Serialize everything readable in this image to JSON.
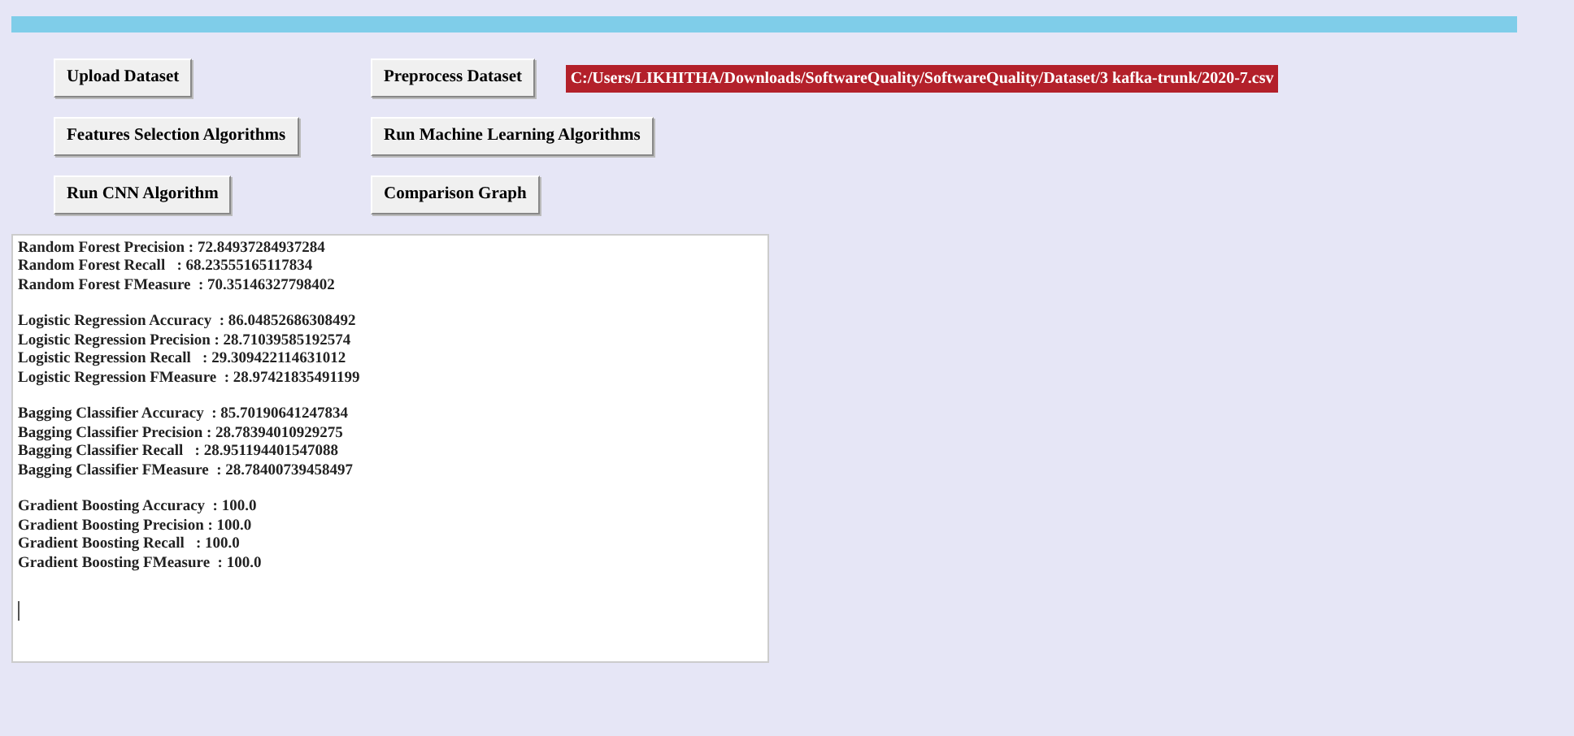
{
  "buttons": [
    [
      "Upload Dataset",
      "Preprocess Dataset"
    ],
    [
      "Features Selection Algorithms",
      "Run Machine Learning Algorithms"
    ],
    [
      "Run CNN Algorithm",
      "Comparison Graph"
    ]
  ],
  "file_path": "C:/Users/LIKHITHA/Downloads/SoftwareQuality/SoftwareQuality/Dataset/3 kafka-trunk/2020-7.csv",
  "output": {
    "groups": [
      [
        "Random Forest Precision : 72.84937284937284",
        "Random Forest Recall   : 68.23555165117834",
        "Random Forest FMeasure  : 70.35146327798402"
      ],
      [
        "Logistic Regression Accuracy  : 86.04852686308492",
        "Logistic Regression Precision : 28.71039585192574",
        "Logistic Regression Recall   : 29.309422114631012",
        "Logistic Regression FMeasure  : 28.97421835491199"
      ],
      [
        "Bagging Classifier Accuracy  : 85.70190641247834",
        "Bagging Classifier Precision : 28.78394010929275",
        "Bagging Classifier Recall   : 28.951194401547088",
        "Bagging Classifier FMeasure  : 28.78400739458497"
      ],
      [
        "Gradient Boosting Accuracy  : 100.0",
        "Gradient Boosting Precision : 100.0",
        "Gradient Boosting Recall   : 100.0",
        "Gradient Boosting FMeasure  : 100.0"
      ]
    ]
  }
}
